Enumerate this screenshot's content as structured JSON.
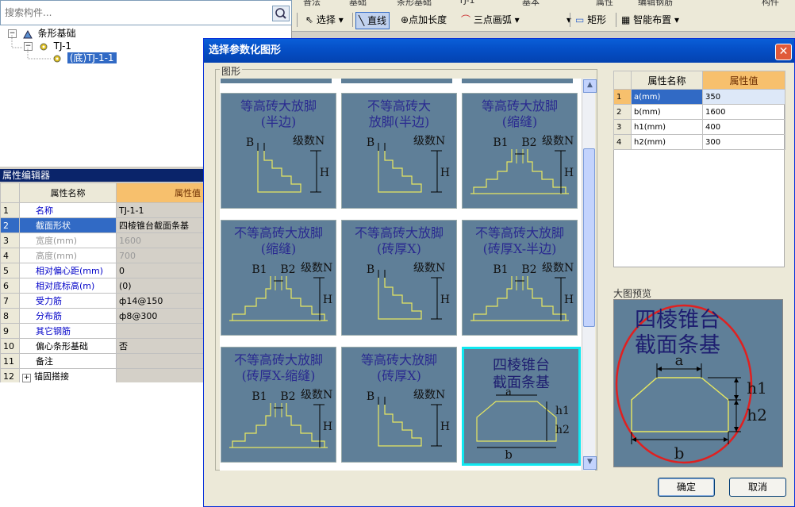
{
  "search": {
    "placeholder": "搜索构件..."
  },
  "tree": {
    "root": "条形基础",
    "child": "TJ-1",
    "leaf": "(底)TJ-1-1"
  },
  "toolbar": {
    "top_items": [
      "普法",
      "基础",
      "条形基础",
      "TJ-1",
      "基本",
      "属性",
      "编辑钢筋",
      "构件"
    ],
    "select": "选择",
    "line": "直线",
    "point_len": "点加长度",
    "arc": "三点画弧",
    "rect": "矩形",
    "smart": "智能布置"
  },
  "prop_editor": {
    "title": "属性编辑器",
    "col_name": "属性名称",
    "col_value": "属性值",
    "rows": [
      {
        "n": "1",
        "name": "名称",
        "value": "TJ-1-1"
      },
      {
        "n": "2",
        "name": "截面形状",
        "value": "四棱锥台截面条基"
      },
      {
        "n": "3",
        "name": "宽度(mm)",
        "value": "1600"
      },
      {
        "n": "4",
        "name": "高度(mm)",
        "value": "700"
      },
      {
        "n": "5",
        "name": "相对偏心距(mm)",
        "value": "0"
      },
      {
        "n": "6",
        "name": "相对底标高(m)",
        "value": "(0)"
      },
      {
        "n": "7",
        "name": "受力筋",
        "value": "ф14@150"
      },
      {
        "n": "8",
        "name": "分布筋",
        "value": "ф8@300"
      },
      {
        "n": "9",
        "name": "其它钢筋",
        "value": ""
      },
      {
        "n": "10",
        "name": "偏心条形基础",
        "value": "否"
      },
      {
        "n": "11",
        "name": "备注",
        "value": ""
      },
      {
        "n": "12",
        "name": "锚固搭接",
        "value": ""
      }
    ]
  },
  "dialog": {
    "title": "选择参数化图形",
    "close": "✕",
    "group_label": "图形",
    "tiles": [
      {
        "title": "等高砖大放脚\n(半边)"
      },
      {
        "title": "不等高砖大\n放脚(半边)"
      },
      {
        "title": "等高砖大放脚\n(缩缝)"
      },
      {
        "title": "不等高砖大放脚\n(缩缝)"
      },
      {
        "title": "不等高砖大放脚\n(砖厚X)"
      },
      {
        "title": "不等高砖大放脚\n(砖厚X-半边)"
      },
      {
        "title": "不等高砖大放脚\n(砖厚X-缩缝)"
      },
      {
        "title": "等高砖大放脚\n(砖厚X)"
      },
      {
        "title": "四棱锥台\n截面条基"
      }
    ],
    "labels": {
      "B": "B",
      "B1": "B1",
      "B2": "B2",
      "N": "级数N",
      "H": "H",
      "a": "a",
      "b": "b",
      "h1": "h1",
      "h2": "h2"
    },
    "attr_table": {
      "col_name": "属性名称",
      "col_value": "属性值",
      "rows": [
        {
          "n": "1",
          "name": "a(mm)",
          "value": "350"
        },
        {
          "n": "2",
          "name": "b(mm)",
          "value": "1600"
        },
        {
          "n": "3",
          "name": "h1(mm)",
          "value": "400"
        },
        {
          "n": "4",
          "name": "h2(mm)",
          "value": "300"
        }
      ]
    },
    "preview_label": "大图预览",
    "preview_title": "四棱锥台\n截面条基",
    "ok": "确定",
    "cancel": "取消"
  },
  "colors": {
    "tile_bg": "#5f7f98",
    "title_bar": "#0550c8",
    "selected_border": "#10e8f0",
    "drawing": "#e8e860"
  }
}
